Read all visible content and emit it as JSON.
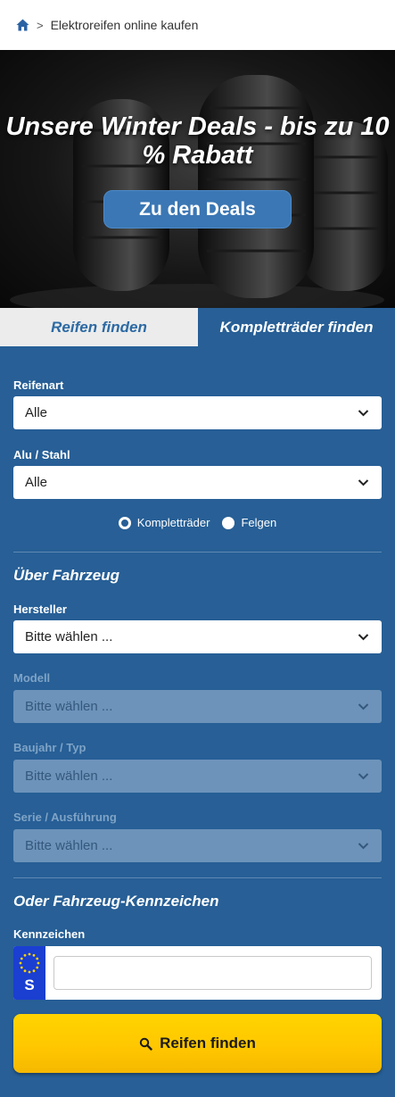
{
  "breadcrumb": {
    "home_icon": "home-icon",
    "separator": ">",
    "current": "Elektroreifen online kaufen"
  },
  "hero": {
    "title": "Unsere Winter Deals - bis zu 10 % Rabatt",
    "button_label": "Zu den Deals"
  },
  "tabs": [
    {
      "label": "Reifen finden",
      "active": false
    },
    {
      "label": "Kompletträder finden",
      "active": true
    }
  ],
  "form": {
    "reifenart": {
      "label": "Reifenart",
      "value": "Alle"
    },
    "alu_stahl": {
      "label": "Alu / Stahl",
      "value": "Alle"
    },
    "radio_options": [
      {
        "label": "Kompletträder",
        "checked": true
      },
      {
        "label": "Felgen",
        "checked": false
      }
    ],
    "vehicle_section_title": "Über Fahrzeug",
    "hersteller": {
      "label": "Hersteller",
      "value": "Bitte wählen ..."
    },
    "modell": {
      "label": "Modell",
      "value": "Bitte wählen ...",
      "disabled": true
    },
    "baujahr": {
      "label": "Baujahr / Typ",
      "value": "Bitte wählen ...",
      "disabled": true
    },
    "serie": {
      "label": "Serie / Ausführung",
      "value": "Bitte wählen ...",
      "disabled": true
    },
    "plate_section_title": "Oder Fahrzeug-Kennzeichen",
    "kennzeichen": {
      "label": "Kennzeichen",
      "country_code": "S",
      "value": ""
    },
    "submit_label": "Reifen finden",
    "submit_icon": "search-icon"
  },
  "colors": {
    "panel_blue": "#275f96",
    "button_blue": "#3b77b4",
    "submit_yellow": "#ffcc00",
    "eu_blue": "#1a3fd1"
  }
}
